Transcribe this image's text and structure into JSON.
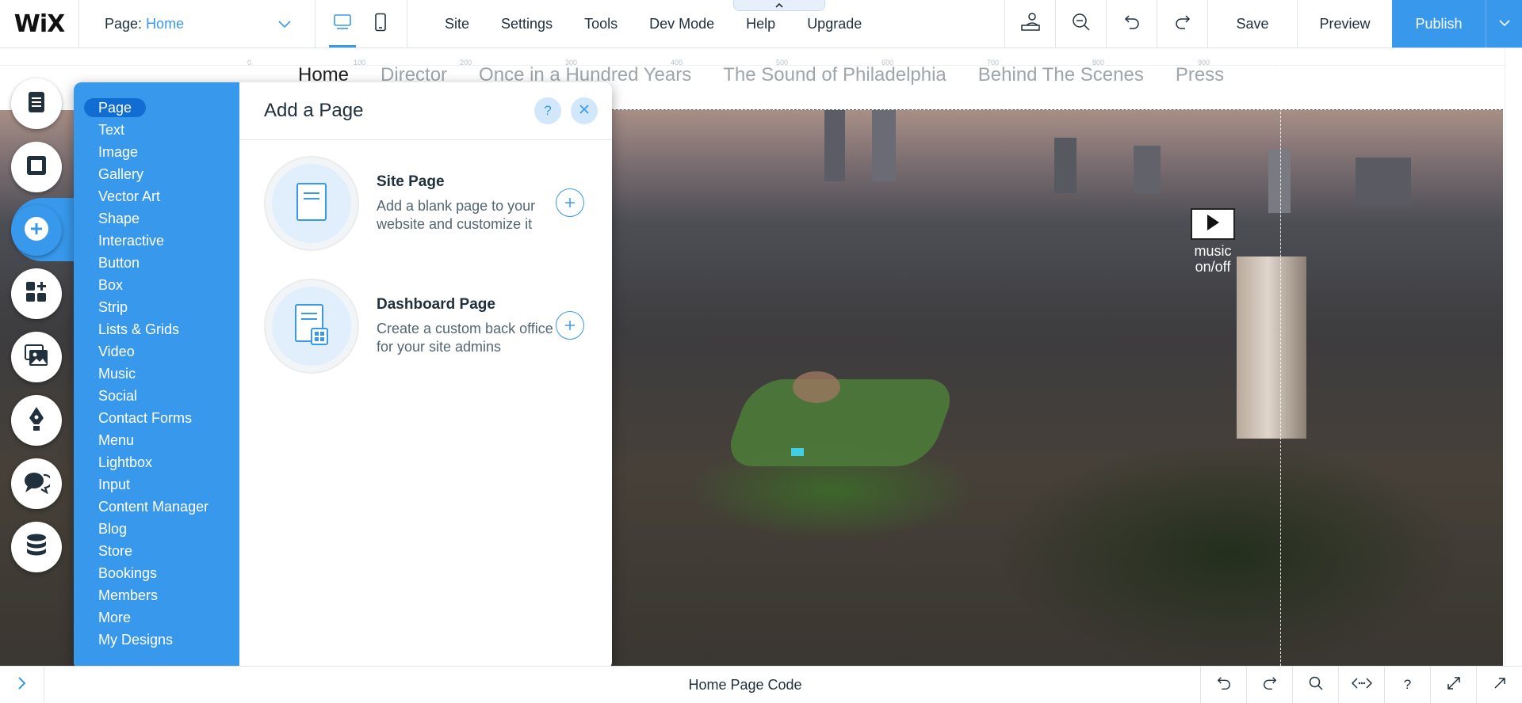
{
  "app": {
    "logo": "WiX"
  },
  "page_selector": {
    "label": "Page:",
    "value": "Home"
  },
  "top_menu": [
    "Site",
    "Settings",
    "Tools",
    "Dev Mode",
    "Help",
    "Upgrade"
  ],
  "actions": {
    "save": "Save",
    "preview": "Preview",
    "publish": "Publish"
  },
  "accent_color": "#3899ec",
  "ruler": [
    "0",
    "100",
    "200",
    "300",
    "400",
    "500",
    "600",
    "700",
    "800",
    "900"
  ],
  "site": {
    "nav": [
      "Home",
      "Director",
      "Once in a Hundred Years",
      "The Sound of Philadelphia",
      "Behind The Scenes",
      "Press"
    ],
    "music_toggle": "music on/off"
  },
  "add_panel": {
    "categories": [
      "Page",
      "Text",
      "Image",
      "Gallery",
      "Vector Art",
      "Shape",
      "Interactive",
      "Button",
      "Box",
      "Strip",
      "Lists & Grids",
      "Video",
      "Music",
      "Social",
      "Contact Forms",
      "Menu",
      "Lightbox",
      "Input",
      "Content Manager",
      "Blog",
      "Store",
      "Bookings",
      "Members",
      "More",
      "My Designs"
    ],
    "selected_category": "Page",
    "title": "Add a Page",
    "help": "?",
    "options": [
      {
        "title": "Site Page",
        "description": "Add a blank page to your website and customize it",
        "icon": "page-icon"
      },
      {
        "title": "Dashboard Page",
        "description": "Create a custom back office for your site admins",
        "icon": "dashboard-page-icon"
      }
    ]
  },
  "bottom_bar": {
    "title": "Home Page Code"
  },
  "icons": [
    "desktop-icon",
    "mobile-icon",
    "layers-icon",
    "zoom-out-icon",
    "undo-icon",
    "redo-icon",
    "chevron-down-icon",
    "chevron-right-icon",
    "play-icon",
    "search-icon",
    "code-icon",
    "help-icon",
    "expand-icon",
    "external-icon"
  ]
}
